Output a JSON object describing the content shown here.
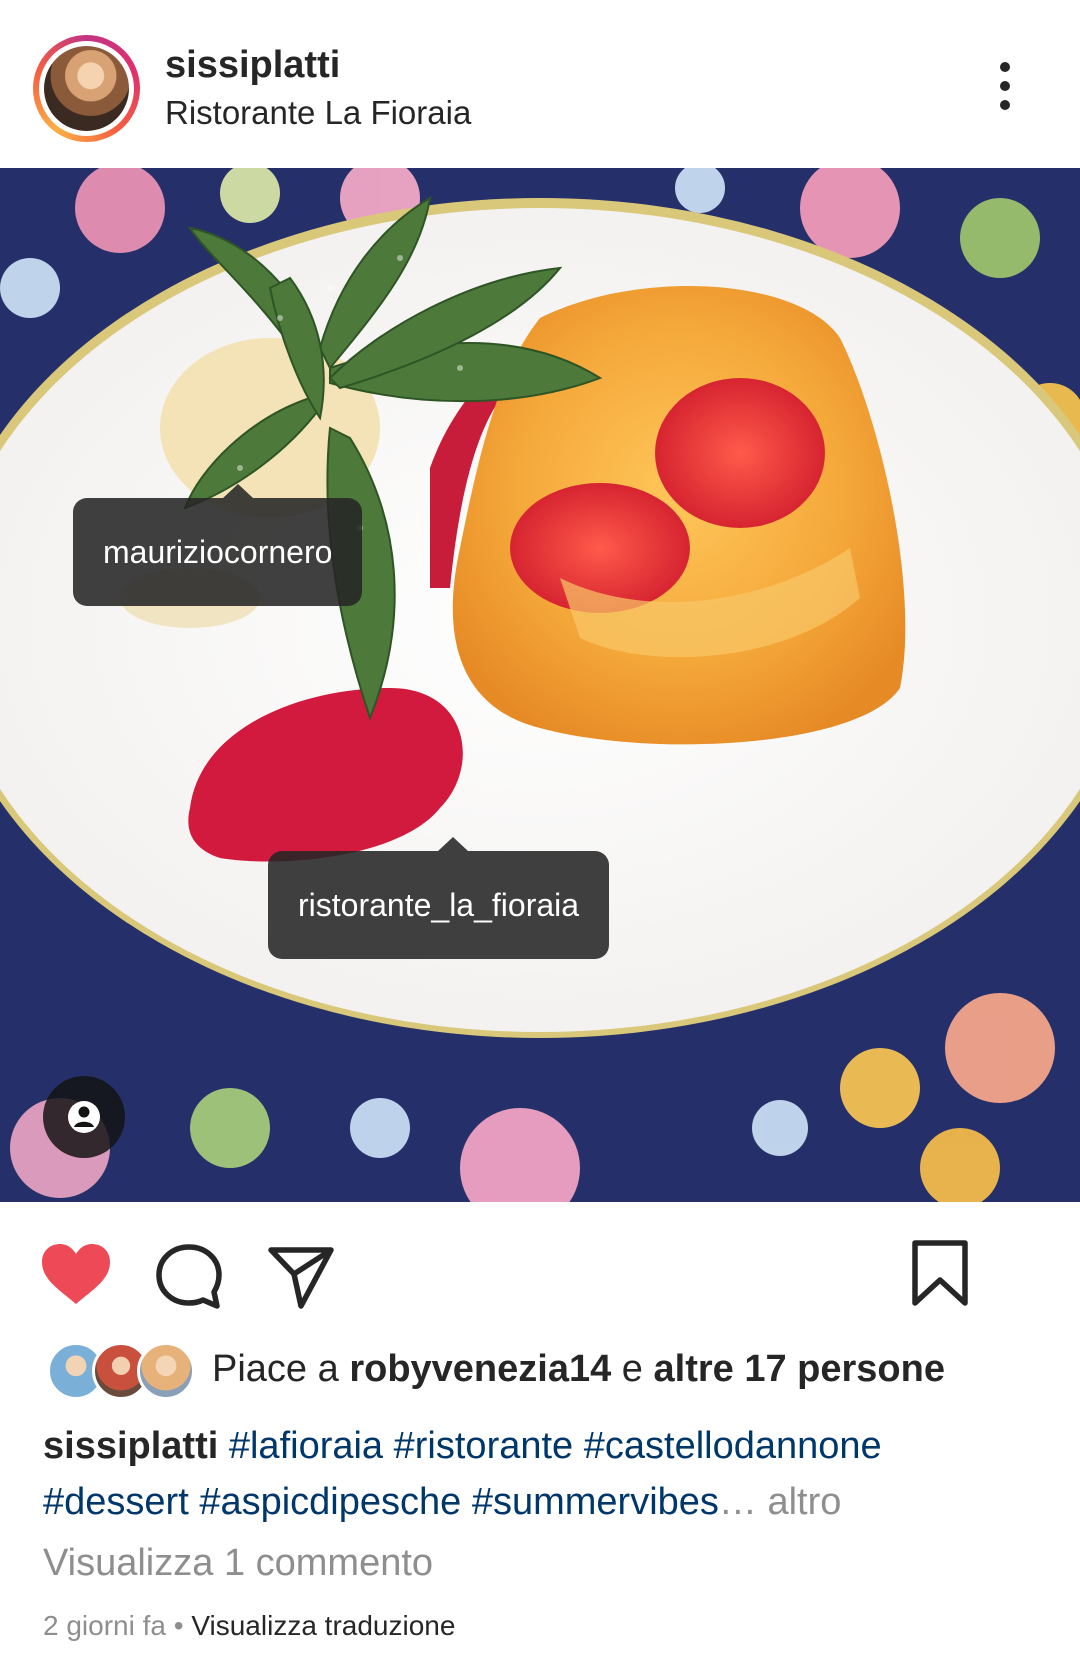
{
  "post": {
    "username": "sissiplatti",
    "location": "Ristorante La Fioraia"
  },
  "tags": {
    "tag1": "mauriziocornero",
    "tag2": "ristorante_la_fioraia"
  },
  "likes": {
    "prefix": "Piace a",
    "liker": "robyvenezia14",
    "connector": "e",
    "others": "altre 17 persone"
  },
  "caption": {
    "username": "sissiplatti",
    "hashtags": [
      "#lafioraia",
      "#ristorante",
      "#castellodannone",
      "#dessert",
      "#aspicdipesche",
      "#summervibes"
    ],
    "ellipsis": "…",
    "more": "altro"
  },
  "comments": {
    "view_label": "Visualizza 1 commento"
  },
  "meta": {
    "time": "2 giorni fa",
    "separator": "•",
    "translate": "Visualizza traduzione"
  },
  "colors": {
    "like_red": "#ed4956",
    "hashtag_blue": "#00376b",
    "muted_gray": "#8e8e8e"
  },
  "icons": {
    "like": "heart-icon",
    "comment": "comment-icon",
    "share": "send-icon",
    "save": "bookmark-icon",
    "tagged_people": "person-icon",
    "options": "more-vertical-icon"
  }
}
